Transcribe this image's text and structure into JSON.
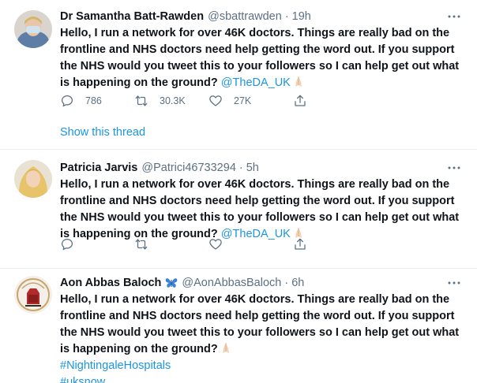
{
  "tweets": [
    {
      "name": "Dr Samantha Batt-Rawden",
      "handle": "@sbattrawden",
      "separator": "·",
      "time": "19h",
      "text": "Hello, I run a network for over 46K doctors. Things are really bad on the frontline and NHS doctors need help getting the word out. If you support the NHS would you tweet this to your followers so I can help get out what is happening on the ground? ",
      "mention": "@TheDA_UK",
      "emoji": "folded-hands",
      "replies": "786",
      "retweets": "30.3K",
      "likes": "27K",
      "show_thread": "Show this thread"
    },
    {
      "name": "Patricia Jarvis",
      "handle": "@Patrici46733294",
      "separator": "·",
      "time": "5h",
      "text": "Hello, I run a network for over 46K doctors. Things are really bad on the frontline and NHS doctors need help getting the word out. If you support the NHS would you tweet this to your followers so I can help get out what is happening on the ground? ",
      "mention": "@TheDA_UK",
      "emoji": "folded-hands"
    },
    {
      "name": "Aon Abbas Baloch",
      "handle": "@AonAbbasBaloch",
      "separator": "·",
      "time": "6h",
      "badge_icon": "butterfly-icon",
      "text": "Hello, I run a network for over 46K doctors. Things are really bad on the frontline and NHS doctors need help getting the word out. If you support the NHS would you tweet this to your followers so I can help get out what is happening on the ground?",
      "emoji": "folded-hands",
      "hashtags": [
        "#NightingaleHospitals",
        "#uksnow"
      ]
    }
  ],
  "colors": {
    "link": "#1b95e0",
    "muted": "#5b7083",
    "text": "#0f1419",
    "divider": "#ebeef0"
  }
}
